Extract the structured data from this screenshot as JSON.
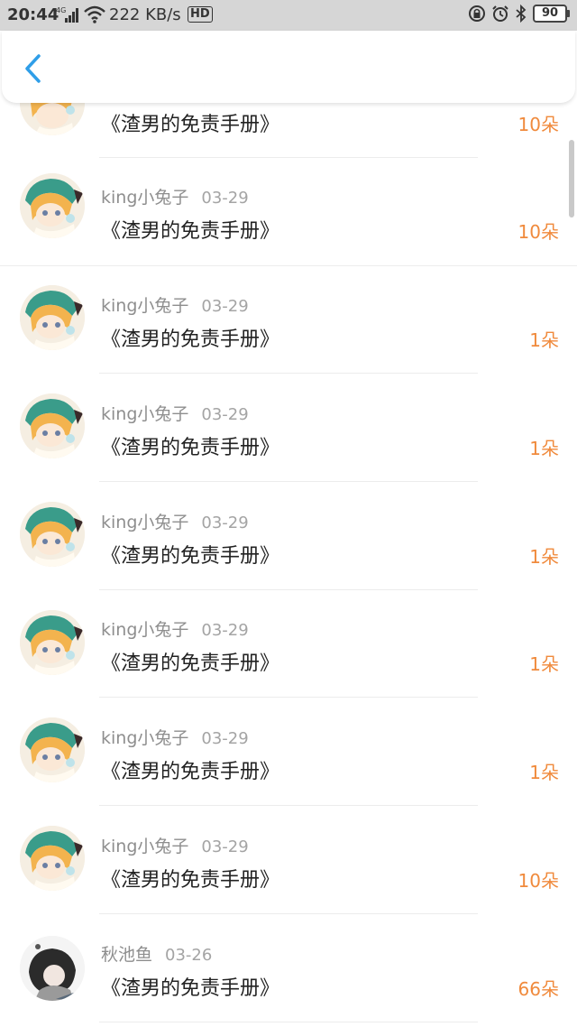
{
  "status_bar": {
    "time": "20:44",
    "network": "4G",
    "speed": "222 KB/s",
    "hd": "HD",
    "battery": "90"
  },
  "items": [
    {
      "user": "",
      "date": "",
      "title": "《渣男的免责手册》",
      "amount": "10朵"
    },
    {
      "user": "king小兔子",
      "date": "03-29",
      "title": "《渣男的免责手册》",
      "amount": "10朵"
    },
    {
      "user": "king小兔子",
      "date": "03-29",
      "title": "《渣男的免责手册》",
      "amount": "1朵"
    },
    {
      "user": "king小兔子",
      "date": "03-29",
      "title": "《渣男的免责手册》",
      "amount": "1朵"
    },
    {
      "user": "king小兔子",
      "date": "03-29",
      "title": "《渣男的免责手册》",
      "amount": "1朵"
    },
    {
      "user": "king小兔子",
      "date": "03-29",
      "title": "《渣男的免责手册》",
      "amount": "1朵"
    },
    {
      "user": "king小兔子",
      "date": "03-29",
      "title": "《渣男的免责手册》",
      "amount": "1朵"
    },
    {
      "user": "king小兔子",
      "date": "03-29",
      "title": "《渣男的免责手册》",
      "amount": "10朵"
    },
    {
      "user": "秋池鱼",
      "date": "03-26",
      "title": "《渣男的免责手册》",
      "amount": "66朵"
    }
  ],
  "colors": {
    "accent": "#2f9ee8",
    "amount": "#f08a3c"
  }
}
